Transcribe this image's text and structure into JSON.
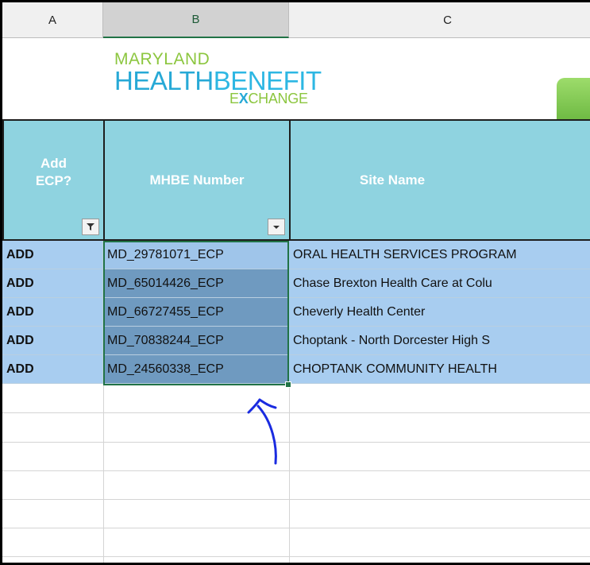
{
  "columns": {
    "a": "A",
    "b": "B",
    "c": "C"
  },
  "logo": {
    "line1": "MARYLAND",
    "line2_a": "HEALTH",
    "line2_b": "BENEFIT",
    "line3_a": "E",
    "line3_x": "X",
    "line3_b": "CHANGE"
  },
  "headers": {
    "add_ecp": "Add ECP?",
    "mhbe_number": "MHBE Number",
    "site_name": "Site Name"
  },
  "rows": [
    {
      "add": "ADD",
      "mhbe": "MD_29781071_ECP",
      "site": "ORAL HEALTH SERVICES PROGRAM"
    },
    {
      "add": "ADD",
      "mhbe": "MD_65014426_ECP",
      "site": "Chase Brexton Health Care at Colu"
    },
    {
      "add": "ADD",
      "mhbe": "MD_66727455_ECP",
      "site": "Cheverly Health Center"
    },
    {
      "add": "ADD",
      "mhbe": "MD_70838244_ECP",
      "site": "Choptank - North Dorcester High S"
    },
    {
      "add": "ADD",
      "mhbe": "MD_24560338_ECP",
      "site": "CHOPTANK COMMUNITY HEALTH"
    }
  ],
  "colors": {
    "header_fill": "#8fd3e0",
    "selection_border": "#217346",
    "row_fill": "#a8cdf0",
    "selected_cell_fill": "#6f9ac0",
    "annotation_arrow": "#1a2be0"
  },
  "icons": {
    "filter_applied": "filter-applied-icon",
    "dropdown": "dropdown-arrow-icon"
  }
}
